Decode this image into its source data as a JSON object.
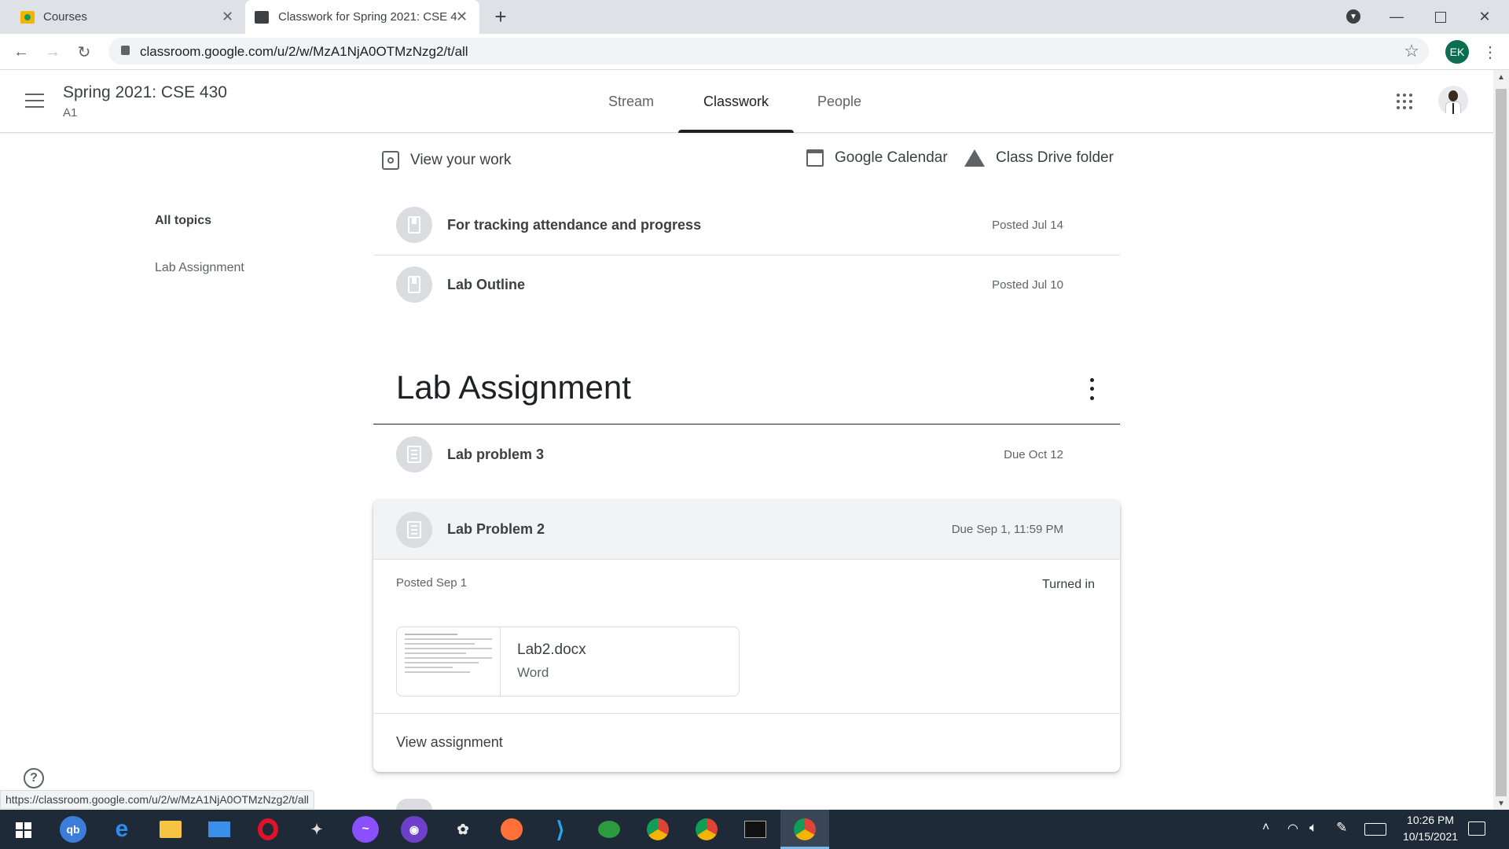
{
  "browser": {
    "tabs": [
      {
        "label": "Courses",
        "active": false
      },
      {
        "label": "Classwork for Spring 2021: CSE 4",
        "active": true
      }
    ],
    "new_tab": "+",
    "url": "classroom.google.com/u/2/w/MzA1NjA0OTMzNzg2/t/all",
    "profile_initials": "EK",
    "status_url": "https://classroom.google.com/u/2/w/MzA1NjA0OTMzNzg2/t/all"
  },
  "header": {
    "course_title": "Spring 2021: CSE 430",
    "section": "A1",
    "tabs": [
      "Stream",
      "Classwork",
      "People"
    ],
    "active_tab": "Classwork"
  },
  "actions": {
    "view_work": "View your work",
    "calendar": "Google Calendar",
    "drive": "Class Drive folder"
  },
  "topics": {
    "all": "All topics",
    "items": [
      "Lab Assignment"
    ]
  },
  "materials": [
    {
      "title": "For tracking attendance and progress",
      "date": "Posted Jul 14"
    },
    {
      "title": "Lab Outline",
      "date": "Posted Jul 10"
    }
  ],
  "section_title": "Lab Assignment",
  "assignments": [
    {
      "title": "Lab problem 3",
      "date": "Due Oct 12"
    },
    {
      "title": "Lab Problem 2",
      "date": "Due Sep 1, 11:59 PM"
    }
  ],
  "expanded": {
    "posted": "Posted Sep 1",
    "status": "Turned in",
    "attachment_name": "Lab2.docx",
    "attachment_type": "Word",
    "view_link": "View assignment"
  },
  "taskbar": {
    "time": "10:26 PM",
    "date": "10/15/2021"
  },
  "colors": {
    "accent_dark": "#202124",
    "circle_gray": "#dadce0",
    "taskbar": "#1f2a38"
  }
}
